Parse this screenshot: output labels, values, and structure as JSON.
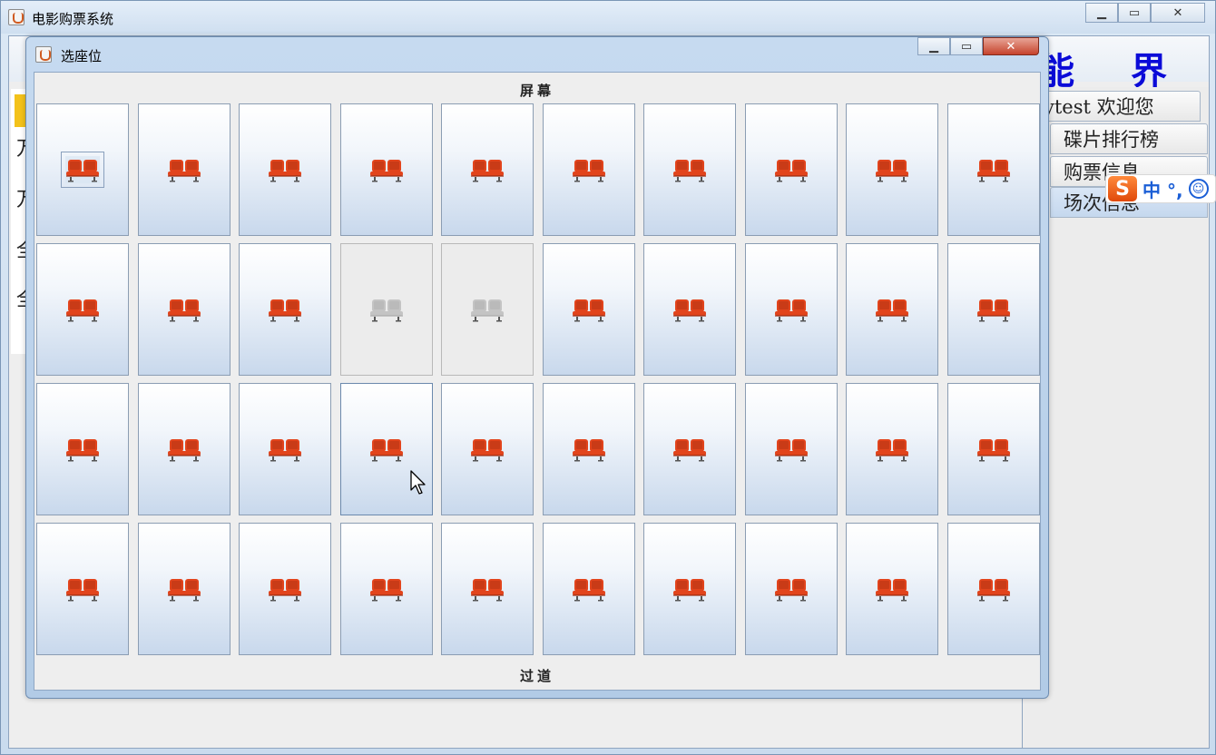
{
  "main_window": {
    "title": "电影购票系统",
    "banner": "能 界",
    "left_strip_chars": [
      "万",
      "万",
      "全",
      "全"
    ],
    "side_tabs": [
      {
        "label": "ytest 欢迎您",
        "selected": false
      },
      {
        "label": "碟片排行榜",
        "selected": false
      },
      {
        "label": "购票信息",
        "selected": false
      },
      {
        "label": "场次信息",
        "selected": true
      }
    ]
  },
  "ime": {
    "logo": "S",
    "text": "中 °,",
    "face": "☺"
  },
  "dialog": {
    "title": "选座位",
    "screen_label": "屏幕",
    "aisle_label": "过道",
    "rows": 4,
    "cols": 10,
    "sold_seats": [
      [
        1,
        3
      ],
      [
        1,
        4
      ]
    ],
    "hover_seat": [
      2,
      3
    ],
    "focus_seat": [
      0,
      0
    ],
    "colors": {
      "seat_available": "#e2441c",
      "seat_sold": "#c4c4c4"
    }
  }
}
